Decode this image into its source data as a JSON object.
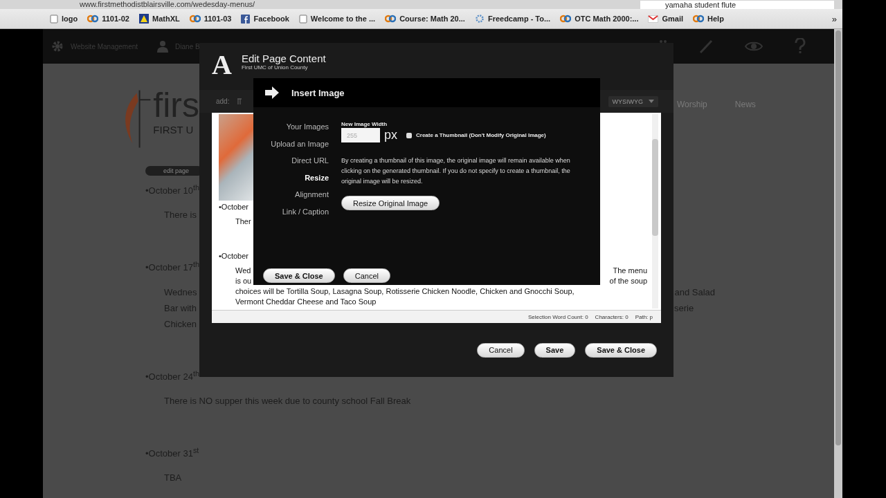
{
  "browser": {
    "url": "www.firstmethodistblairsville.com/wedesday-menus/",
    "search": "yamaha student flute",
    "overflow": "»",
    "bookmarks": [
      "logo",
      "1101-02",
      "MathXL",
      "1101-03",
      "Facebook",
      "Welcome to the ...",
      "Course: Math 20...",
      "Freedcamp - To...",
      "OTC Math 2000:...",
      "Gmail",
      "Help"
    ]
  },
  "admin_bar": {
    "site_label": "Website Management",
    "user": "Diane B"
  },
  "site": {
    "logo_word": "firs",
    "logo_sub": "FIRST U",
    "nav": [
      "Worship",
      "News"
    ],
    "edit_page": "edit page",
    "entries": [
      {
        "date": "•October 10$^{th}$",
        "rows": [
          {
            "left": "There is"
          }
        ]
      },
      {
        "date": "•October 17$^{th}$",
        "rows": [
          {
            "left": "Wednes",
            "right": "and Salad"
          },
          {
            "left": "Bar with",
            "right": "serie"
          },
          {
            "left": "Chicken"
          }
        ]
      },
      {
        "date": "•October 24$^{th}$",
        "rows": [
          {
            "left": "There is NO supper this week due to county school Fall Break"
          }
        ]
      },
      {
        "date": "•October 31$^{st}$",
        "rows": [
          {
            "left": "TBA"
          }
        ]
      }
    ]
  },
  "editor_modal": {
    "logo_letter": "A",
    "title": "Edit Page Content",
    "subtitle": "First UMC of Union County",
    "toolbar_label": "add:",
    "mode": "WYSIWYG",
    "content": [
      {
        "kind": "date",
        "text": "•October"
      },
      {
        "kind": "line",
        "left": "Ther"
      },
      {
        "kind": "date",
        "text": "•October"
      },
      {
        "kind": "line",
        "left": "Wed",
        "right": "The menu"
      },
      {
        "kind": "line",
        "left": "is ou",
        "right": "of the soup"
      },
      {
        "kind": "line",
        "left": "choices will be Tortilla Soup, Lasagna Soup, Rotisserie Chicken Noodle, Chicken and Gnocchi Soup,"
      },
      {
        "kind": "line",
        "left": "Vermont Cheddar Cheese and Taco Soup"
      }
    ],
    "status": [
      "Selection Word Count: 0",
      "Characters: 0",
      "Path: p"
    ],
    "buttons": [
      {
        "label": "Cancel",
        "primary": false
      },
      {
        "label": "Save",
        "primary": true
      },
      {
        "label": "Save & Close",
        "primary": true
      }
    ]
  },
  "insert_image": {
    "title": "Insert Image",
    "tabs": [
      {
        "label": "Your Images",
        "selected": false
      },
      {
        "label": "Upload an Image",
        "selected": false
      },
      {
        "label": "Direct URL",
        "selected": false
      },
      {
        "label": "Resize",
        "selected": true
      },
      {
        "label": "Alignment",
        "selected": false
      },
      {
        "label": "Link / Caption",
        "selected": false
      }
    ],
    "width_label": "New Image Width",
    "width_value": "255",
    "unit": "px",
    "thumbnail": {
      "label": "Create a Thumbnail (Don't Modify Original Image)",
      "checked": false
    },
    "note": "By creating a thumbnail of this image, the original image will remain available when clicking on the generated thumbnail. If you do not specify to create a thumbnail, the original image will be resized.",
    "resize_button": "Resize Original Image",
    "buttons": [
      {
        "label": "Save & Close",
        "primary": true
      },
      {
        "label": "Cancel",
        "primary": false
      }
    ]
  }
}
